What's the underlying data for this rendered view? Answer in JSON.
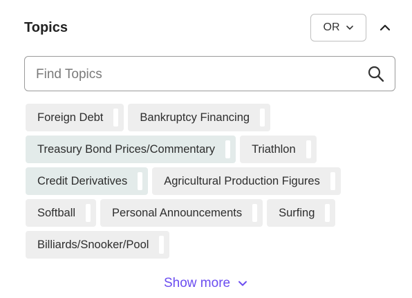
{
  "header": {
    "title": "Topics",
    "operator": "OR",
    "chevron_icon": "chevron-down-icon",
    "collapse_icon": "chevron-up-icon"
  },
  "search": {
    "placeholder": "Find Topics",
    "value": "",
    "icon": "search-icon"
  },
  "topics": [
    {
      "label": "Foreign Debt"
    },
    {
      "label": "Bankruptcy Financing"
    },
    {
      "label": "Treasury Bond Prices/Commentary"
    },
    {
      "label": "Triathlon"
    },
    {
      "label": "Credit Derivatives"
    },
    {
      "label": "Agricultural Production Figures"
    },
    {
      "label": "Softball"
    },
    {
      "label": "Personal Announcements"
    },
    {
      "label": "Surfing"
    },
    {
      "label": "Billiards/Snooker/Pool"
    }
  ],
  "show_more": {
    "label": "Show more",
    "icon": "chevron-down-icon"
  },
  "colors": {
    "accent": "#6b4df0",
    "chip_bg": "#eeeeee",
    "chip_bg_highlight": "#e3ebea"
  }
}
